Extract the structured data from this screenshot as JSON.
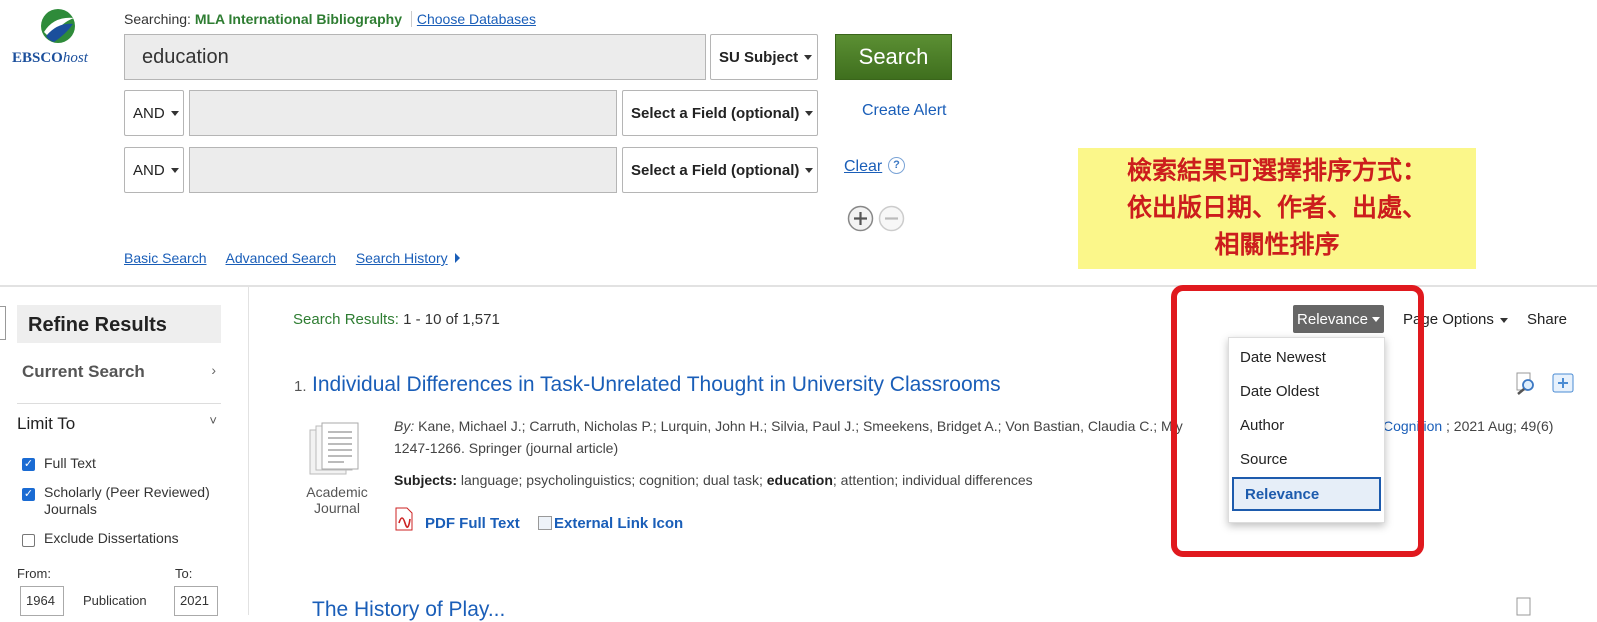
{
  "logo": {
    "ebsco": "EBSCO",
    "host": "host"
  },
  "header": {
    "searching_label": "Searching:",
    "database": "MLA International Bibliography",
    "choose_databases": "Choose Databases"
  },
  "search": {
    "query": "education",
    "field1": "SU Subject",
    "bool2": "AND",
    "field2": "Select a Field (optional)",
    "bool3": "AND",
    "field3": "Select a Field (optional)",
    "search_button": "Search",
    "create_alert": "Create Alert",
    "clear": "Clear",
    "help": "?"
  },
  "nav_links": {
    "basic": "Basic Search",
    "advanced": "Advanced Search",
    "history": "Search History"
  },
  "annotation": {
    "line1": "檢索結果可選擇排序方式：",
    "line2": "依出版日期、作者、出處、",
    "line3": "相關性排序",
    "color": "#cc1d1d",
    "background": "#fbf78a",
    "highlight_border": "#e0191e"
  },
  "sidebar": {
    "title": "Refine Results",
    "current_search": "Current Search",
    "limit_to": "Limit To",
    "limits": [
      {
        "label": "Full Text",
        "checked": true
      },
      {
        "label": "Scholarly (Peer Reviewed) Journals",
        "checked": true
      },
      {
        "label": "Exclude Dissertations",
        "checked": false
      }
    ],
    "from_label": "From:",
    "to_label": "To:",
    "from_value": "1964",
    "to_value": "2021",
    "publication_label": "Publication"
  },
  "results": {
    "label": "Search Results:",
    "range": "1 - 10 of 1,571",
    "sort_button": "Relevance",
    "page_options": "Page Options",
    "share": "Share",
    "sort_options": [
      "Date Newest",
      "Date Oldest",
      "Author",
      "Source",
      "Relevance"
    ],
    "selected_sort": "Relevance",
    "items": [
      {
        "number": "1.",
        "title": "Individual Differences in Task-Unrelated Thought in University Classrooms",
        "by_label": "By:",
        "authors": "Kane, Michael J.; Carruth, Nicholas P.; Lurquin, John H.; Silvia, Paul J.; Smeekens, Bridget A.; Von Bastian, Claudia C.; Miy",
        "source_link": "Cognition",
        "source_rest": "; 2021 Aug; 49(6)",
        "pages_line": "1247-1266. Springer (journal article)",
        "subjects_label": "Subjects:",
        "subjects_pre": "language; psycholinguistics; cognition; dual task;",
        "subjects_bold": "education",
        "subjects_post": "; attention; individual differences",
        "type_line1": "Academic",
        "type_line2": "Journal",
        "pdf_link": "PDF Full Text",
        "external_link": "External Link Icon"
      }
    ],
    "second_title_partial": "The History of Play..."
  }
}
